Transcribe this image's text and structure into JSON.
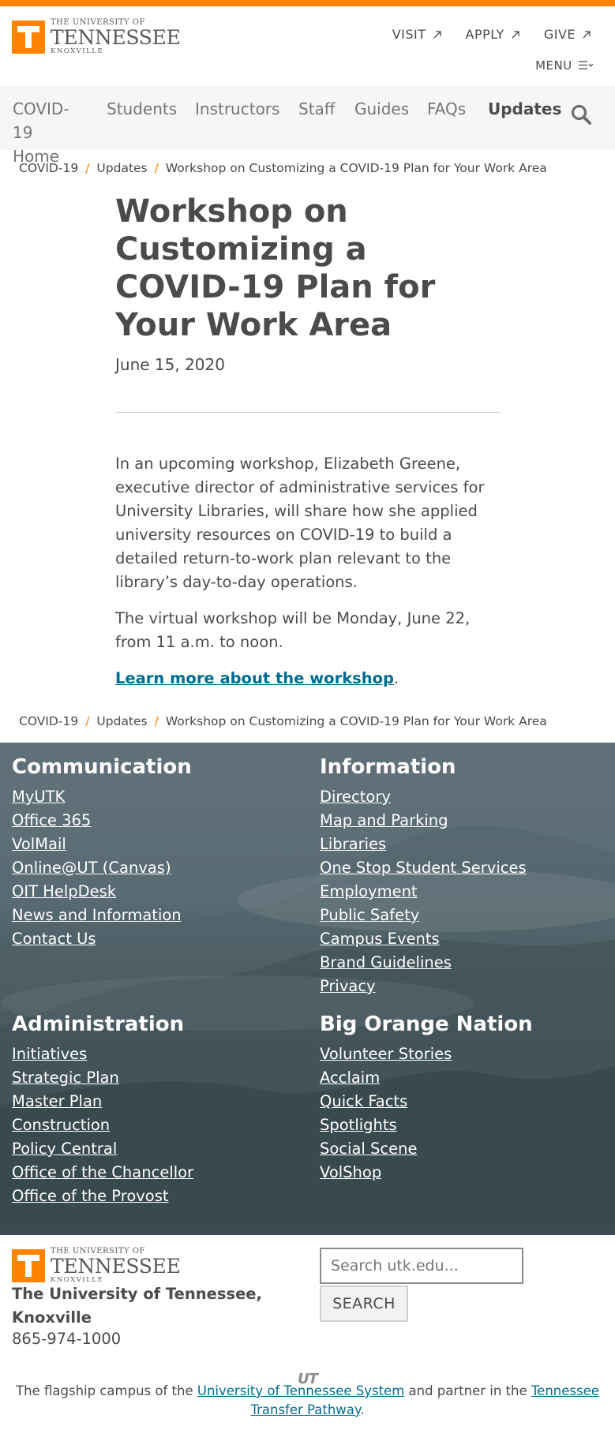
{
  "header": {
    "logo": {
      "line1": "THE UNIVERSITY OF",
      "line2": "TENNESSEE",
      "line3": "KNOXVILLE"
    },
    "utility": [
      {
        "label": "VISIT",
        "icon": "external-arrow-icon"
      },
      {
        "label": "APPLY",
        "icon": "external-arrow-icon"
      },
      {
        "label": "GIVE",
        "icon": "external-arrow-icon"
      }
    ],
    "menu_label": "MENU",
    "menu_icon": "hamburger-icon"
  },
  "nav": {
    "items": [
      "COVID-19 Home",
      "Students",
      "Instructors",
      "Staff",
      "Guides",
      "FAQs",
      "Updates"
    ],
    "active": "Updates",
    "search_icon": "search-icon"
  },
  "breadcrumb": [
    "COVID-19",
    "Updates",
    "Workshop on Customizing a COVID-19 Plan for Your Work Area"
  ],
  "article": {
    "title": "Workshop on Customizing a COVID-19 Plan for Your Work Area",
    "date": "June 15, 2020",
    "paragraphs": [
      "In an upcoming workshop, Elizabeth Greene, executive director of administrative services for University Libraries, will share how she applied university resources on COVID-19 to build a detailed return-to-work plan relevant to the library’s day-to-day operations.",
      "The virtual workshop will be Monday, June 22, from 11 a.m. to noon."
    ],
    "link_text": "Learn more about the workshop",
    "link_suffix": "."
  },
  "footer": {
    "communication": {
      "heading": "Communication",
      "links": [
        "MyUTK",
        "Office 365",
        "VolMail",
        "Online@UT (Canvas)",
        "OIT HelpDesk",
        "News and Information",
        "Contact Us"
      ]
    },
    "information": {
      "heading": "Information",
      "links": [
        "Directory",
        "Map and Parking",
        "Libraries",
        "One Stop Student Services",
        "Employment",
        "Public Safety",
        "Campus Events",
        "Brand Guidelines",
        "Privacy"
      ]
    },
    "administration": {
      "heading": "Administration",
      "links": [
        "Initiatives",
        "Strategic Plan",
        "Master Plan",
        "Construction",
        "Policy Central",
        "Office of the Chancellor",
        "Office of the Provost"
      ]
    },
    "big_orange": {
      "heading": "Big Orange Nation",
      "links": [
        "Volunteer Stories",
        "Acclaim",
        "Quick Facts",
        "Spotlights",
        "Social Scene",
        "VolShop"
      ]
    }
  },
  "bottom": {
    "name": "The University of Tennessee, Knoxville",
    "phone": "865-974-1000",
    "search_placeholder": "Search utk.edu...",
    "search_button": "SEARCH",
    "ut_mark": "UT",
    "flagship_prefix": "The flagship campus of the ",
    "flagship_link1": "University of Tennessee System",
    "flagship_middle": " and partner in the ",
    "flagship_link2": "Tennessee Transfer Pathway",
    "flagship_suffix": "."
  },
  "colors": {
    "orange": "#FF8200",
    "link": "#006C93",
    "text": "#4B4B4B"
  }
}
